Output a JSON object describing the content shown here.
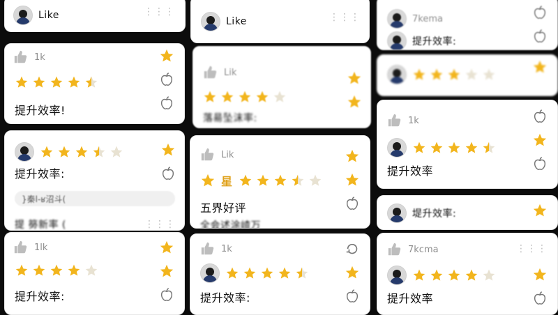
{
  "text": {
    "like": "Like",
    "lik": "Lik",
    "lk": "1k",
    "lm": "1lk",
    "kcma": "7kcma",
    "kema": "7kema",
    "efficiency": "提升效率",
    "efficiency_colon": "提升效率:",
    "efficiency_bang": "提升效率!",
    "five_star": "五界好评",
    "star_char": "星",
    "garbled_1": "落昜坠沫率:",
    "garbled_2": "}秦l-ʁ沼斗(",
    "garbled_3": "提 簩新率 (",
    "garbled_4": "全会述涂嵖万",
    "garbled_5": "堤升效率:",
    "garbled_6": "提 升效运率",
    "dots": "⋮⋮⋮"
  },
  "colors": {
    "star_full": "#f2b51d",
    "star_empty": "#e8e2d2",
    "accent": "#e0a11a",
    "card": "#ffffff",
    "bg": "#0c0c0c"
  },
  "ratings": {
    "full": 5,
    "four": 4,
    "four_half": 4.5,
    "three_half": 3.5,
    "three": 3
  },
  "icons": [
    "like-thumb-icon",
    "star-icon",
    "apple-icon",
    "dots-grid-icon",
    "avatar-icon",
    "refresh-icon"
  ]
}
